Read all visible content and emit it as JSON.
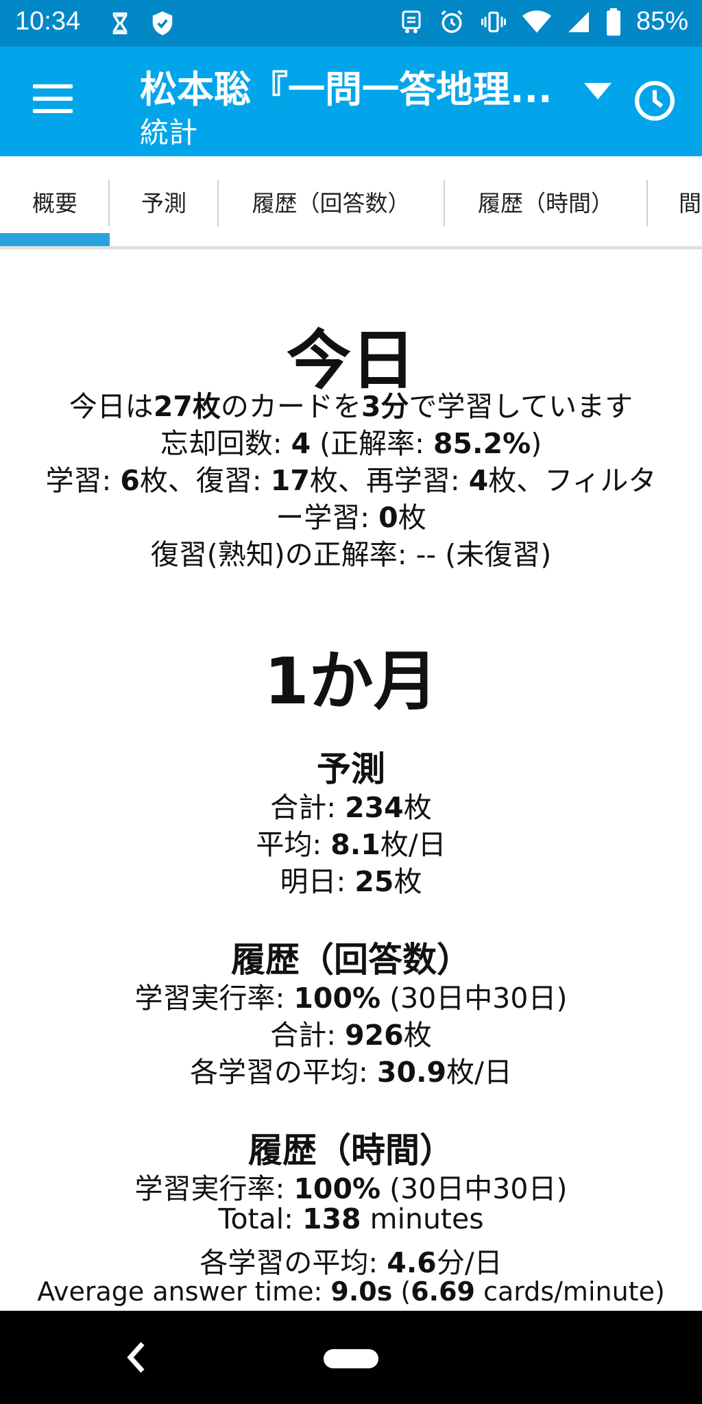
{
  "status_bar": {
    "time": "10:34",
    "battery": "85%",
    "icons_left": [
      "hourglass-icon",
      "shield-icon"
    ],
    "icons_right": [
      "sim-icon",
      "alarm-icon",
      "vibrate-icon",
      "wifi-icon",
      "signal-icon",
      "battery-icon"
    ]
  },
  "app_bar": {
    "title": "松本聡『一問一答地理...",
    "subtitle": "統計",
    "background": "#03a5ea",
    "status_background": "#0288c7"
  },
  "tabs": [
    {
      "label": "概要",
      "selected": true
    },
    {
      "label": "予測"
    },
    {
      "label": "履歴（回答数）"
    },
    {
      "label": "履歴（時間）"
    },
    {
      "label": "間"
    }
  ],
  "today": {
    "heading": "今日",
    "l1": {
      "a": "今日は",
      "cards": "27枚",
      "b": "のカードを",
      "time": "3分",
      "c": "で学習しています"
    },
    "l2": {
      "a": "忘却回数: ",
      "lapses": "4",
      "b": " (正解率: ",
      "rate": "85.2%",
      "c": ")"
    },
    "l3": {
      "a": "学習: ",
      "learn": "6",
      "b": "枚、復習: ",
      "review": "17",
      "c": "枚、再学習: ",
      "relearn": "4",
      "d": "枚、フィルタ"
    },
    "l4": {
      "a": "ー学習: ",
      "filtered": "0",
      "b": "枚"
    },
    "l5": {
      "a": "復習(熟知)の正解率: -- (未復習)"
    }
  },
  "month": {
    "heading": "1か月",
    "forecast": {
      "title": "予測",
      "total": {
        "a": "合計: ",
        "v": "234",
        "b": "枚"
      },
      "avg": {
        "a": "平均: ",
        "v": "8.1",
        "b": "枚/日"
      },
      "tomorrow": {
        "a": "明日: ",
        "v": "25",
        "b": "枚"
      }
    },
    "history_count": {
      "title": "履歴（回答数）",
      "rate": {
        "a": "学習実行率: ",
        "v": "100%",
        "b": " (30日中30日)"
      },
      "total": {
        "a": "合計: ",
        "v": "926",
        "b": "枚"
      },
      "avg": {
        "a": "各学習の平均: ",
        "v": "30.9",
        "b": "枚/日"
      }
    },
    "history_time": {
      "title": "履歴（時間）",
      "rate": {
        "a": "学習実行率: ",
        "v": "100%",
        "b": " (30日中30日)"
      },
      "total": {
        "a": "Total: ",
        "v": "138",
        "b": " minutes"
      },
      "avg": {
        "a": "各学習の平均: ",
        "v": "4.6",
        "b": "分/日"
      },
      "answer": {
        "a": "Average answer time: ",
        "v": "9.0s",
        "b": " (",
        "v2": "6.69",
        "c": " cards/minute)"
      }
    }
  }
}
